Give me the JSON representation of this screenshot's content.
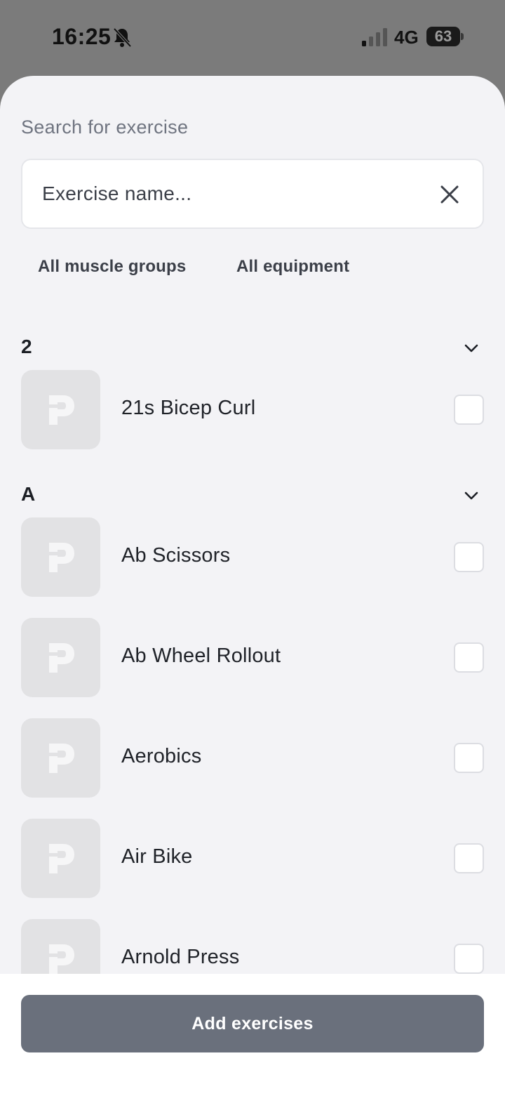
{
  "status_bar": {
    "time": "16:25",
    "network": "4G",
    "battery": "63",
    "icons": [
      "bell-muted-icon",
      "signal-icon",
      "battery-icon"
    ]
  },
  "sheet": {
    "title": "Search for exercise",
    "search": {
      "placeholder": "Exercise name...",
      "value": "",
      "clear_icon": "close-icon"
    },
    "filters": {
      "muscle": "All muscle groups",
      "equipment": "All equipment"
    },
    "sections": [
      {
        "letter": "2",
        "items": [
          {
            "name": "21s Bicep Curl",
            "checked": false
          }
        ]
      },
      {
        "letter": "A",
        "items": [
          {
            "name": "Ab Scissors",
            "checked": false
          },
          {
            "name": "Ab Wheel Rollout",
            "checked": false
          },
          {
            "name": "Aerobics",
            "checked": false
          },
          {
            "name": "Air Bike",
            "checked": false
          },
          {
            "name": "Arnold Press",
            "checked": false
          }
        ]
      }
    ]
  },
  "footer": {
    "add_label": "Add exercises"
  },
  "colors": {
    "sheet_bg": "#f3f3f6",
    "button_bg": "#6a707c",
    "thumb_bg": "#e2e2e4"
  }
}
